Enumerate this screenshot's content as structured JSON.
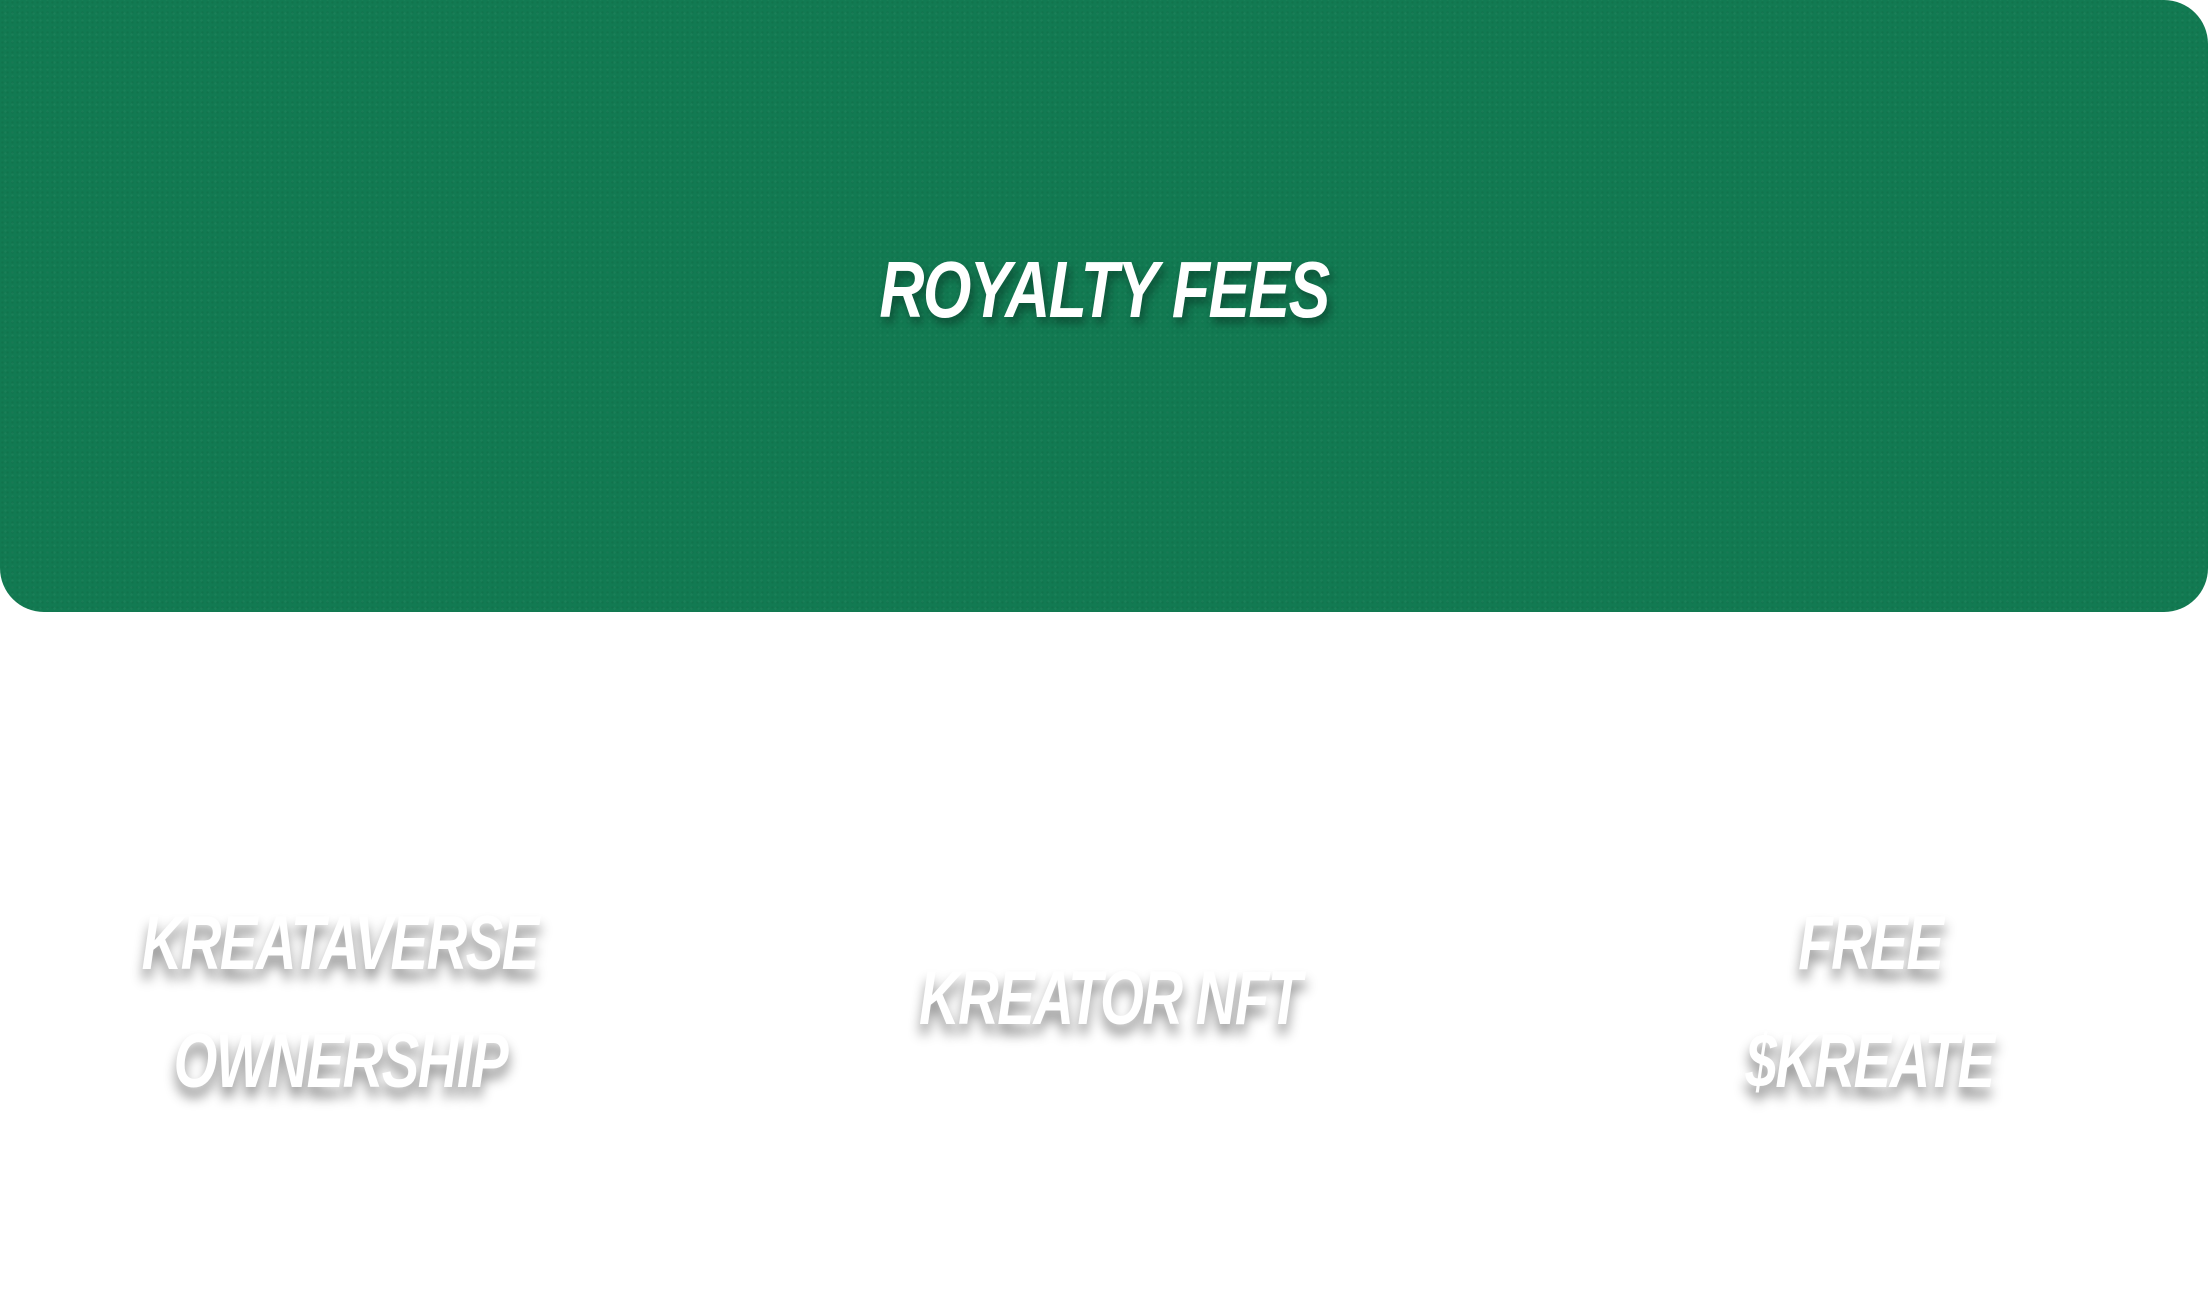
{
  "hero": {
    "title": "ROYALTY FEES",
    "background_color": "#127a52"
  },
  "features": {
    "ownership": {
      "line1": "KREATAVERSE",
      "line2": "OWNERSHIP"
    },
    "nft": {
      "line1": "KREATOR NFT"
    },
    "kreate": {
      "line1": "FREE",
      "line2": "$KREATE"
    }
  }
}
